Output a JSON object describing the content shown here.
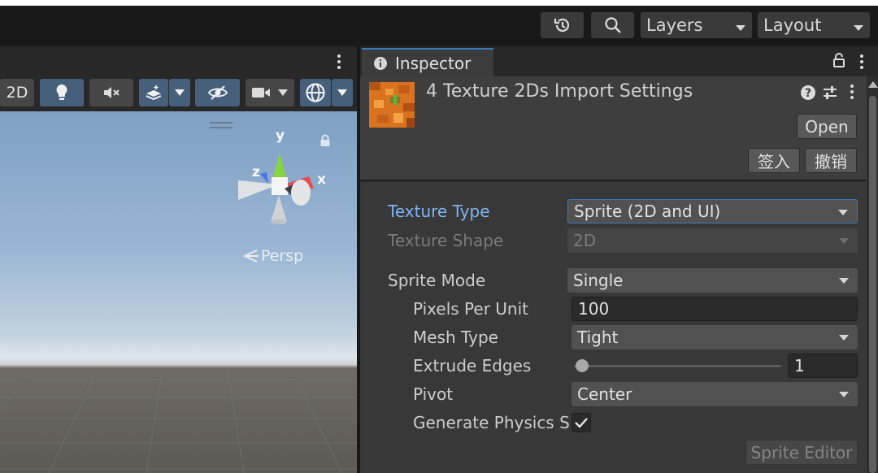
{
  "toolbar": {
    "history_icon": "history-icon",
    "search_icon": "search-icon",
    "layers_label": "Layers",
    "layout_label": "Layout"
  },
  "scene": {
    "tool_2d_label": "2D",
    "gizmo_axis_y": "y",
    "gizmo_axis_x": "x",
    "gizmo_axis_z": "z",
    "persp_label": "Persp"
  },
  "inspector": {
    "tab_title": "Inspector",
    "asset_title": "4 Texture 2Ds Import Settings",
    "open_button": "Open",
    "checkin_button": "签入",
    "revert_button": "撤销",
    "fields": {
      "texture_type_label": "Texture Type",
      "texture_type_value": "Sprite (2D and UI)",
      "texture_shape_label": "Texture Shape",
      "texture_shape_value": "2D",
      "sprite_mode_label": "Sprite Mode",
      "sprite_mode_value": "Single",
      "pixels_per_unit_label": "Pixels Per Unit",
      "pixels_per_unit_value": "100",
      "mesh_type_label": "Mesh Type",
      "mesh_type_value": "Tight",
      "extrude_edges_label": "Extrude Edges",
      "extrude_edges_value": "1",
      "extrude_edges_slider_fraction": 0.03,
      "pivot_label": "Pivot",
      "pivot_value": "Center",
      "generate_physics_label": "Generate Physics S",
      "generate_physics_checked": true
    },
    "sprite_editor_button": "Sprite Editor"
  },
  "colors": {
    "accent_blue": "#3a79bb",
    "focused_label": "#7eb4f2",
    "panel_bg": "#383838",
    "toolbar_bg": "#191919"
  }
}
